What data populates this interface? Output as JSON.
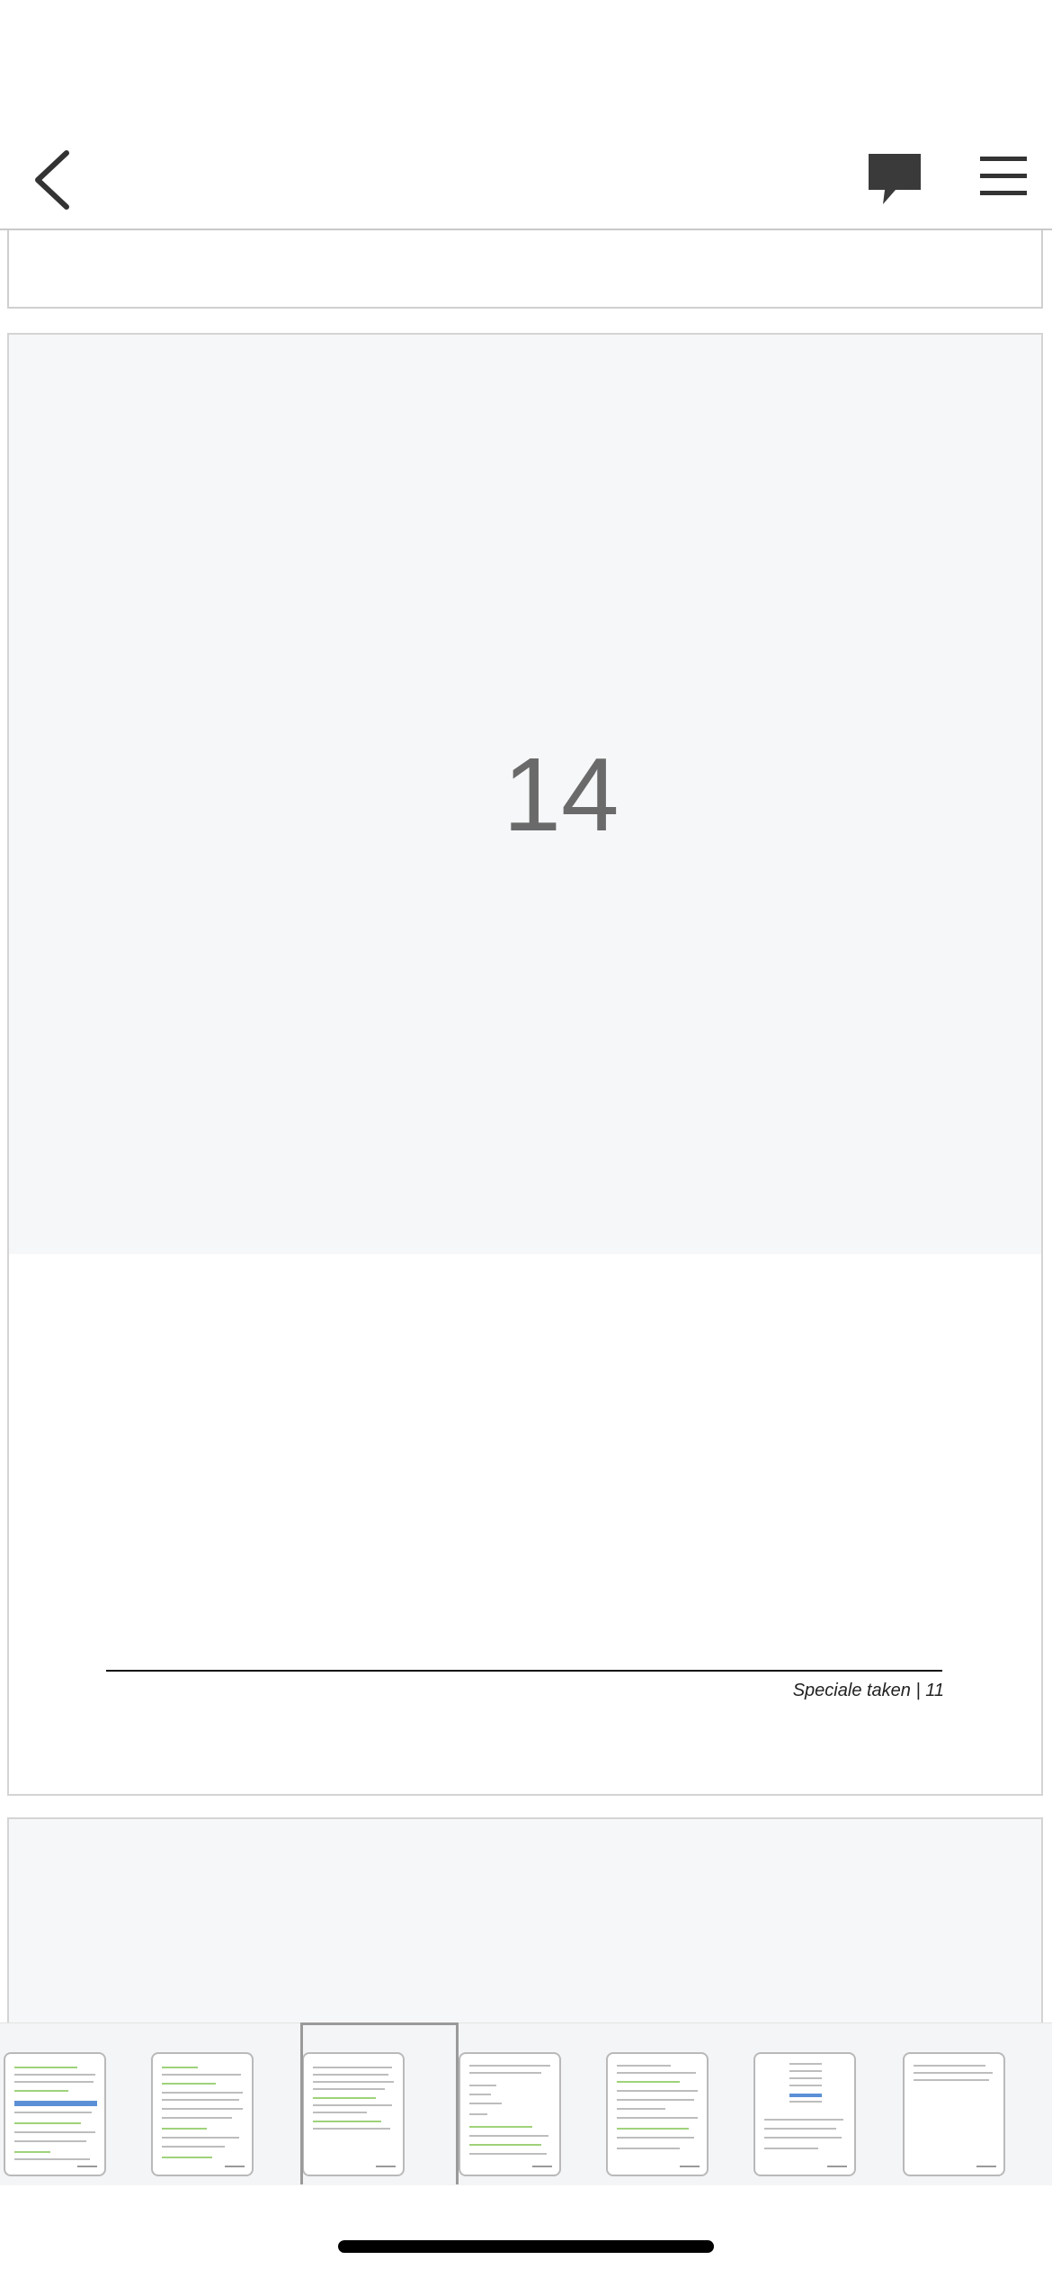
{
  "toolbar": {
    "back_icon": "chevron-left-icon",
    "comment_icon": "comment-icon",
    "menu_icon": "hamburger-menu-icon"
  },
  "document": {
    "current_page_placeholder": "14",
    "footer_text": "Speciale taken | 11"
  },
  "thumbnails": {
    "count": 7,
    "selected_index": 2
  },
  "colors": {
    "accent_green": "#9fd27a",
    "placeholder_bg": "#f6f7f9"
  }
}
